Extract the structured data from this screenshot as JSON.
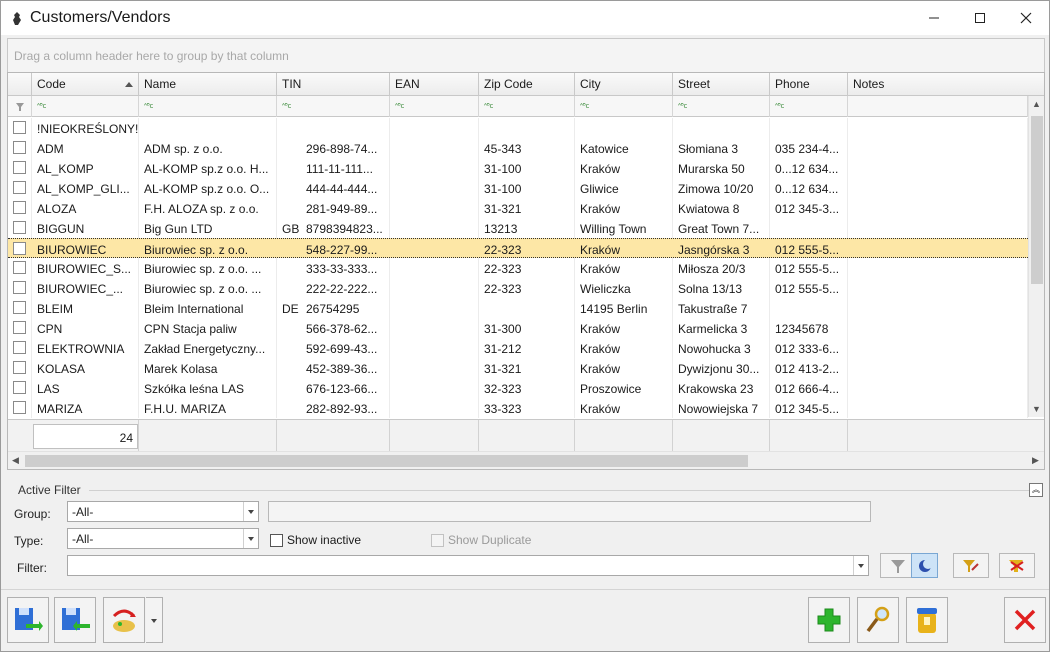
{
  "window": {
    "title": "Customers/Vendors",
    "minimize_icon": "minimize-icon",
    "maximize_icon": "maximize-icon",
    "close_icon": "close-icon"
  },
  "grid": {
    "group_by_hint": "Drag a column header here to group by that column",
    "columns": [
      {
        "key": "code",
        "label": "Code",
        "sorted": "ascending"
      },
      {
        "key": "name",
        "label": "Name"
      },
      {
        "key": "tin",
        "label": "TIN"
      },
      {
        "key": "ean",
        "label": "EAN"
      },
      {
        "key": "zip",
        "label": "Zip Code"
      },
      {
        "key": "city",
        "label": "City"
      },
      {
        "key": "street",
        "label": "Street"
      },
      {
        "key": "phone",
        "label": "Phone"
      },
      {
        "key": "notes",
        "label": "Notes"
      }
    ],
    "filter_row_glyph": "ᴬᴮc",
    "rows": [
      {
        "code": "!NIEOKREŚLONY!",
        "name": "",
        "tin_prefix": "",
        "tin": "",
        "ean": "",
        "zip": "",
        "city": "",
        "street": "",
        "phone": "",
        "notes": ""
      },
      {
        "code": "ADM",
        "name": "ADM sp. z o.o.",
        "tin_prefix": "",
        "tin": "296-898-74...",
        "ean": "",
        "zip": "45-343",
        "city": "Katowice",
        "street": "Słomiana 3",
        "phone": "035 234-4...",
        "notes": ""
      },
      {
        "code": "AL_KOMP",
        "name": "AL-KOMP sp.z o.o. H...",
        "tin_prefix": "",
        "tin": "111-11-111...",
        "ean": "",
        "zip": "31-100",
        "city": "Kraków",
        "street": "Murarska 50",
        "phone": "0...12 634...",
        "notes": ""
      },
      {
        "code": "AL_KOMP_GLI...",
        "name": "AL-KOMP sp.z o.o. O...",
        "tin_prefix": "",
        "tin": "444-44-444...",
        "ean": "",
        "zip": "31-100",
        "city": "Gliwice",
        "street": "Zimowa 10/20",
        "phone": "0...12 634...",
        "notes": ""
      },
      {
        "code": "ALOZA",
        "name": "F.H. ALOZA sp. z o.o.",
        "tin_prefix": "",
        "tin": "281-949-89...",
        "ean": "",
        "zip": "31-321",
        "city": "Kraków",
        "street": "Kwiatowa 8",
        "phone": "012 345-3...",
        "notes": ""
      },
      {
        "code": "BIGGUN",
        "name": "Big Gun LTD",
        "tin_prefix": "GB",
        "tin": "8798394823...",
        "ean": "",
        "zip": "13213",
        "city": "Willing Town",
        "street": "Great Town 7...",
        "phone": "",
        "notes": ""
      },
      {
        "code": "BIUROWIEC",
        "name": "Biurowiec sp. z o.o.",
        "tin_prefix": "",
        "tin": "548-227-99...",
        "ean": "",
        "zip": "22-323",
        "city": "Kraków",
        "street": "Jasngórska  3",
        "phone": "012 555-5...",
        "notes": "",
        "selected": true
      },
      {
        "code": "BIUROWIEC_S...",
        "name": "Biurowiec sp. z o.o. ...",
        "tin_prefix": "",
        "tin": "333-33-333...",
        "ean": "",
        "zip": "22-323",
        "city": "Kraków",
        "street": "Miłosza 20/3",
        "phone": "012 555-5...",
        "notes": ""
      },
      {
        "code": "BIUROWIEC_...",
        "name": "Biurowiec sp. z o.o. ...",
        "tin_prefix": "",
        "tin": "222-22-222...",
        "ean": "",
        "zip": "22-323",
        "city": "Wieliczka",
        "street": "Solna 13/13",
        "phone": "012 555-5...",
        "notes": ""
      },
      {
        "code": "BLEIM",
        "name": "Bleim International",
        "tin_prefix": "DE",
        "tin": "26754295",
        "ean": "",
        "zip": "",
        "city": "14195 Berlin",
        "street": "Takustraße 7",
        "phone": "",
        "notes": ""
      },
      {
        "code": "CPN",
        "name": "CPN Stacja paliw",
        "tin_prefix": "",
        "tin": "566-378-62...",
        "ean": "",
        "zip": "31-300",
        "city": "Kraków",
        "street": "Karmelicka 3",
        "phone": "12345678",
        "notes": ""
      },
      {
        "code": "ELEKTROWNIA",
        "name": "Zakład Energetyczny...",
        "tin_prefix": "",
        "tin": "592-699-43...",
        "ean": "",
        "zip": "31-212",
        "city": "Kraków",
        "street": "Nowohucka  3",
        "phone": "012 333-6...",
        "notes": ""
      },
      {
        "code": "KOLASA",
        "name": "Marek Kolasa",
        "tin_prefix": "",
        "tin": "452-389-36...",
        "ean": "",
        "zip": "31-321",
        "city": "Kraków",
        "street": "Dywizjonu 30...",
        "phone": "012 413-2...",
        "notes": ""
      },
      {
        "code": "LAS",
        "name": "Szkółka leśna LAS",
        "tin_prefix": "",
        "tin": "676-123-66...",
        "ean": "",
        "zip": "32-323",
        "city": "Proszowice",
        "street": "Krakowska  23",
        "phone": "012 666-4...",
        "notes": ""
      },
      {
        "code": "MARIZA",
        "name": "F.H.U. MARIZA",
        "tin_prefix": "",
        "tin": "282-892-93...",
        "ean": "",
        "zip": "33-323",
        "city": "Kraków",
        "street": "Nowowiejska 7",
        "phone": "012 345-5...",
        "notes": ""
      }
    ],
    "record_count": "24"
  },
  "active_filter": {
    "title": "Active Filter",
    "group_label": "Group:",
    "group_value": "-All-",
    "type_label": "Type:",
    "type_value": "-All-",
    "show_inactive_label": "Show inactive",
    "show_duplicate_label": "Show Duplicate",
    "filter_label": "Filter:",
    "filter_value": ""
  },
  "colors": {
    "selected_row": "#fde7a6",
    "add_green": "#2db52d",
    "close_red": "#e02020",
    "accent_blue": "#2f6fd6"
  }
}
